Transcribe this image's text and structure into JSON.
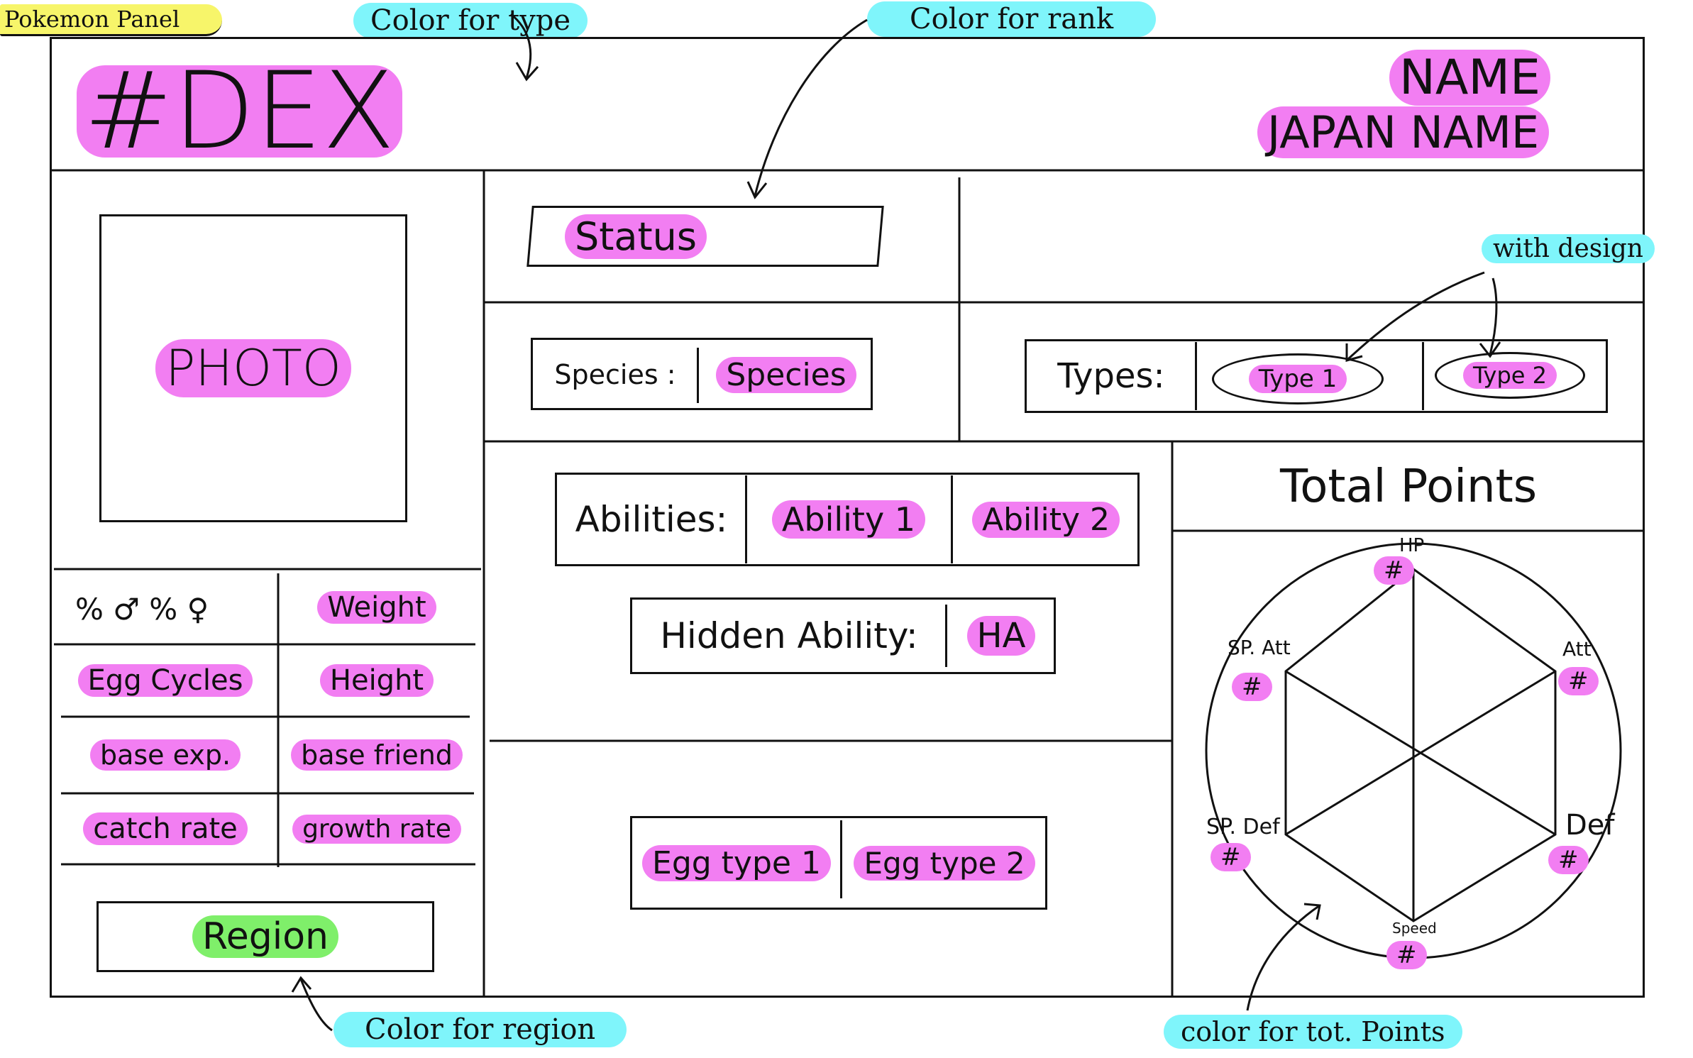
{
  "panel_title": "Pokemon Panel",
  "annotations": {
    "type_color": "Color for type",
    "rank_color": "Color for rank",
    "with_design": "with design",
    "region_color": "Color for region",
    "total_points_color": "color for tot. Points"
  },
  "header": {
    "dex": "#DEX",
    "name": "NAME",
    "japan_name": "JAPAN NAME"
  },
  "photo": "PHOTO",
  "stats_table": {
    "gender": "% ♂ % ♀",
    "weight": "Weight",
    "egg_cycles": "Egg Cycles",
    "height": "Height",
    "base_exp": "base exp.",
    "base_friend": "base friend",
    "catch_rate": "catch rate",
    "growth_rate": "growth rate"
  },
  "region": "Region",
  "status": "Status",
  "species": {
    "label": "Species :",
    "value": "Species"
  },
  "types": {
    "label": "Types:",
    "type1": "Type 1",
    "type2": "Type 2"
  },
  "abilities": {
    "label": "Abilities:",
    "ability1": "Ability 1",
    "ability2": "Ability 2"
  },
  "hidden_ability": {
    "label": "Hidden Ability:",
    "value": "HA"
  },
  "egg_types": {
    "type1": "Egg type 1",
    "type2": "Egg type 2"
  },
  "total_points": {
    "title": "Total Points",
    "hp": "HP",
    "atk": "Att",
    "def": "Def",
    "speed": "Speed",
    "sp_def": "SP. Def",
    "sp_atk": "SP. Att",
    "value_placeholder": "#"
  },
  "colors": {
    "highlight_pink": "#f27ef2",
    "note_cyan": "#7ff5fb",
    "note_yellow": "#f7f56a",
    "region_green": "#7fef6a",
    "ink": "#111111"
  }
}
